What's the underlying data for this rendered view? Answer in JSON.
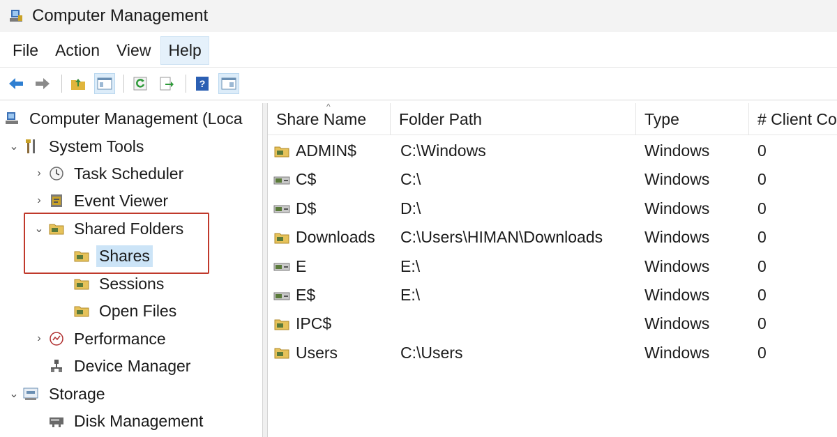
{
  "window": {
    "title": "Computer Management",
    "icon": "computer-management-icon"
  },
  "menu": [
    "File",
    "Action",
    "View",
    "Help"
  ],
  "toolbar": {
    "buttons": [
      "back-arrow-icon",
      "forward-arrow-icon",
      "up-folder-icon",
      "show-hide-tree-icon",
      "refresh-icon",
      "export-list-icon",
      "help-icon",
      "properties-icon"
    ]
  },
  "tree": [
    {
      "label": "Computer Management (Loca",
      "icon": "computer-management-icon",
      "expander": ""
    },
    {
      "label": "System Tools",
      "icon": "tools-icon",
      "expander": "⌄"
    },
    {
      "label": "Task Scheduler",
      "icon": "clock-icon",
      "expander": "›"
    },
    {
      "label": "Event Viewer",
      "icon": "event-viewer-icon",
      "expander": "›"
    },
    {
      "label": "Shared Folders",
      "icon": "shared-folder-icon",
      "expander": "⌄"
    },
    {
      "label": "Shares",
      "icon": "shared-folder-icon",
      "expander": ""
    },
    {
      "label": "Sessions",
      "icon": "shared-folder-icon",
      "expander": ""
    },
    {
      "label": "Open Files",
      "icon": "shared-folder-icon",
      "expander": ""
    },
    {
      "label": "Performance",
      "icon": "performance-icon",
      "expander": "›"
    },
    {
      "label": "Device Manager",
      "icon": "device-manager-icon",
      "expander": ""
    },
    {
      "label": "Storage",
      "icon": "storage-icon",
      "expander": "⌄"
    },
    {
      "label": "Disk Management",
      "icon": "disk-management-icon",
      "expander": ""
    }
  ],
  "columns": [
    "Share Name",
    "Folder Path",
    "Type",
    "# Client Co"
  ],
  "shares": [
    {
      "name": "ADMIN$",
      "path": "C:\\Windows",
      "type": "Windows",
      "clients": "0",
      "icon": "shared-folder-icon"
    },
    {
      "name": "C$",
      "path": "C:\\",
      "type": "Windows",
      "clients": "0",
      "icon": "shared-drive-icon"
    },
    {
      "name": "D$",
      "path": "D:\\",
      "type": "Windows",
      "clients": "0",
      "icon": "shared-drive-icon"
    },
    {
      "name": "Downloads",
      "path": "C:\\Users\\HIMAN\\Downloads",
      "type": "Windows",
      "clients": "0",
      "icon": "shared-folder-icon"
    },
    {
      "name": "E",
      "path": "E:\\",
      "type": "Windows",
      "clients": "0",
      "icon": "shared-drive-icon"
    },
    {
      "name": "E$",
      "path": "E:\\",
      "type": "Windows",
      "clients": "0",
      "icon": "shared-drive-icon"
    },
    {
      "name": "IPC$",
      "path": "",
      "type": "Windows",
      "clients": "0",
      "icon": "shared-folder-icon"
    },
    {
      "name": "Users",
      "path": "C:\\Users",
      "type": "Windows",
      "clients": "0",
      "icon": "shared-folder-icon"
    }
  ],
  "colors": {
    "selection": "#cce4f7",
    "highlight_box": "#c0392b",
    "menu_active": "#e5f1fb"
  }
}
